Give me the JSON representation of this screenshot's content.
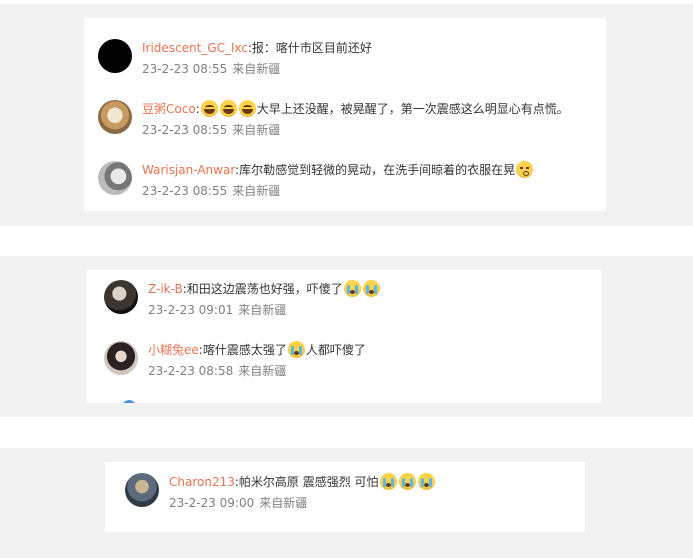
{
  "source_label": "来自新疆",
  "sections": [
    {
      "comments": [
        {
          "user": "Iridescent_GC_lxc",
          "text_a": ":报：喀什市区目前还好",
          "emoji_a": [],
          "text_b": "",
          "emoji_b": [],
          "time": "23-2-23 08:55",
          "avatar": "black-avatar"
        },
        {
          "user": "豆粥Coco",
          "text_a": ":",
          "emoji_a": [
            "laugh-cry-emoji",
            "laugh-cry-emoji",
            "laugh-cry-emoji"
          ],
          "text_b": "大早上还没醒，被晃醒了，第一次震感这么明显心有点慌。",
          "emoji_b": [],
          "time": "23-2-23 08:55",
          "avatar": "cat-avatar"
        },
        {
          "user": "Warisjan-Anwar",
          "text_a": ":库尔勒感觉到轻微的晃动，在洗手间晾着的衣服在晃",
          "emoji_a": [
            "kiss-emoji"
          ],
          "text_b": "",
          "emoji_b": [],
          "time": "23-2-23 08:55",
          "avatar": "portrait-avatar"
        }
      ]
    },
    {
      "comments": [
        {
          "user": "Z-ik-B",
          "text_a": ":和田这边震荡也好强，吓傻了",
          "emoji_a": [
            "crying-emoji",
            "crying-emoji"
          ],
          "text_b": "",
          "emoji_b": [],
          "time": "23-2-23 09:01",
          "avatar": "dark-avatar"
        },
        {
          "user": "小糊兔ee",
          "text_a": ":喀什震感太强了",
          "emoji_a": [
            "crying-emoji"
          ],
          "text_b": "人都吓傻了",
          "emoji_b": [],
          "time": "23-2-23 08:58",
          "avatar": "girl-avatar"
        }
      ]
    },
    {
      "comments": [
        {
          "user": "Charon213",
          "text_a": ":帕米尔高原 震感强烈 可怕",
          "emoji_a": [
            "crying-emoji",
            "crying-emoji",
            "crying-emoji"
          ],
          "text_b": "",
          "emoji_b": [],
          "time": "23-2-23 09:00",
          "avatar": "photo-avatar"
        }
      ]
    }
  ]
}
